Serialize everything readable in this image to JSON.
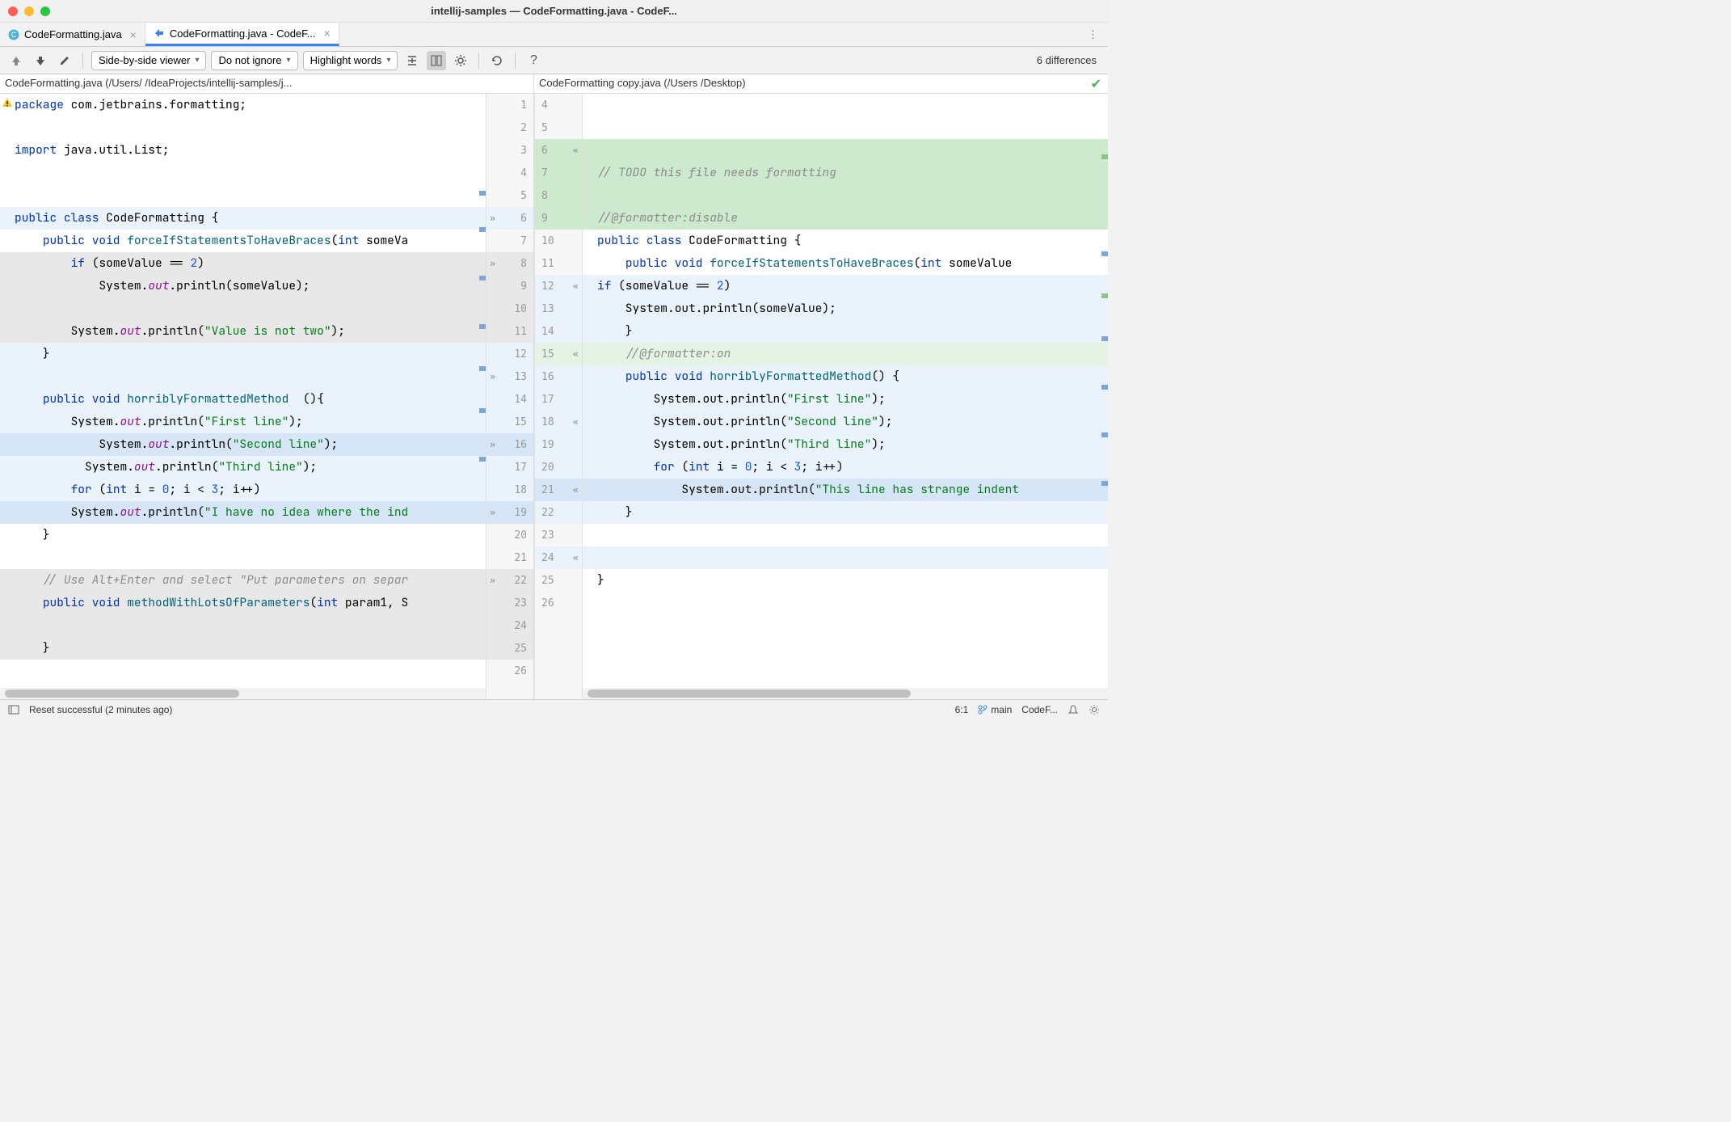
{
  "window": {
    "title": "intellij-samples — CodeFormatting.java - CodeF..."
  },
  "tabs": [
    {
      "label": "CodeFormatting.java",
      "active": false
    },
    {
      "label": "CodeFormatting.java - CodeF...",
      "active": true
    }
  ],
  "toolbar": {
    "viewer_mode": "Side-by-side viewer",
    "ignore_mode": "Do not ignore",
    "highlight_mode": "Highlight words",
    "diff_count": "6 differences"
  },
  "paths": {
    "left": "CodeFormatting.java (/Users/                             /IdeaProjects/intellij-samples/j...",
    "right": "CodeFormatting copy.java (/Users /Desktop)"
  },
  "left_code": [
    {
      "n": 1,
      "segs": [
        [
          "kw",
          "package"
        ],
        [
          "",
          " com.jetbrains.formatting;"
        ]
      ]
    },
    {
      "n": 2,
      "segs": [
        [
          "",
          ""
        ]
      ]
    },
    {
      "n": 3,
      "segs": [
        [
          "kw",
          "import"
        ],
        [
          "",
          " java.util.List;"
        ]
      ]
    },
    {
      "n": 4,
      "segs": [
        [
          "",
          ""
        ]
      ]
    },
    {
      "n": 5,
      "segs": [
        [
          "",
          ""
        ]
      ]
    },
    {
      "n": 6,
      "bg": "mod-light",
      "chev": ">>",
      "segs": [
        [
          "kw",
          "public class"
        ],
        [
          "",
          " CodeFormatting {"
        ]
      ]
    },
    {
      "n": 7,
      "segs": [
        [
          "",
          "    "
        ],
        [
          "kw",
          "public void"
        ],
        [
          "",
          " "
        ],
        [
          "mtd",
          "forceIfStatementsToHaveBraces"
        ],
        [
          "",
          "("
        ],
        [
          "kw",
          "int"
        ],
        [
          "",
          " someVa"
        ]
      ]
    },
    {
      "n": 8,
      "bg": "grey",
      "chev": ">>",
      "segs": [
        [
          "",
          "        "
        ],
        [
          "kw",
          "if"
        ],
        [
          "",
          " (someValue == "
        ],
        [
          "num",
          "2"
        ],
        [
          "",
          ")"
        ]
      ]
    },
    {
      "n": 9,
      "bg": "grey",
      "segs": [
        [
          "",
          "            System."
        ],
        [
          "fld",
          "out"
        ],
        [
          "",
          ".println(someValue);"
        ]
      ]
    },
    {
      "n": 10,
      "bg": "grey",
      "segs": [
        [
          "",
          ""
        ]
      ]
    },
    {
      "n": 11,
      "bg": "grey",
      "segs": [
        [
          "",
          "        System."
        ],
        [
          "fld",
          "out"
        ],
        [
          "",
          ".println("
        ],
        [
          "str",
          "\"Value is not two\""
        ],
        [
          "",
          ");"
        ]
      ]
    },
    {
      "n": 12,
      "bg": "mod-light",
      "segs": [
        [
          "",
          "    }"
        ]
      ]
    },
    {
      "n": 13,
      "bg": "mod-light",
      "chev": ">>",
      "segs": [
        [
          "",
          ""
        ]
      ]
    },
    {
      "n": 14,
      "bg": "mod-light",
      "segs": [
        [
          "",
          "    "
        ],
        [
          "kw",
          "public void"
        ],
        [
          "",
          " "
        ],
        [
          "mtd",
          "horriblyFormattedMethod"
        ],
        [
          "",
          "  (){"
        ]
      ]
    },
    {
      "n": 15,
      "bg": "mod-light",
      "segs": [
        [
          "",
          "        System."
        ],
        [
          "fld",
          "out"
        ],
        [
          "",
          ".println("
        ],
        [
          "str",
          "\"First line\""
        ],
        [
          "",
          ");"
        ]
      ]
    },
    {
      "n": 16,
      "bg": "mod",
      "chev": ">>",
      "segs": [
        [
          "",
          "            System."
        ],
        [
          "fld",
          "out"
        ],
        [
          "",
          ".println("
        ],
        [
          "str",
          "\"Second line\""
        ],
        [
          "",
          ");"
        ]
      ]
    },
    {
      "n": 17,
      "bg": "mod-light",
      "segs": [
        [
          "",
          "          System."
        ],
        [
          "fld",
          "out"
        ],
        [
          "",
          ".println("
        ],
        [
          "str",
          "\"Third line\""
        ],
        [
          "",
          ");"
        ]
      ]
    },
    {
      "n": 18,
      "bg": "mod-light",
      "segs": [
        [
          "",
          "        "
        ],
        [
          "kw",
          "for"
        ],
        [
          "",
          " ("
        ],
        [
          "kw",
          "int"
        ],
        [
          "",
          " i = "
        ],
        [
          "num",
          "0"
        ],
        [
          "",
          "; i < "
        ],
        [
          "num",
          "3"
        ],
        [
          "",
          "; i++)"
        ]
      ]
    },
    {
      "n": 19,
      "bg": "mod",
      "chev": ">>",
      "segs": [
        [
          "",
          "        System."
        ],
        [
          "fld",
          "out"
        ],
        [
          "",
          ".println("
        ],
        [
          "str",
          "\"I have no idea where the ind"
        ]
      ]
    },
    {
      "n": 20,
      "segs": [
        [
          "",
          "    }"
        ]
      ]
    },
    {
      "n": 21,
      "segs": [
        [
          "",
          ""
        ]
      ]
    },
    {
      "n": 22,
      "bg": "grey",
      "chev": ">>",
      "segs": [
        [
          "",
          "    "
        ],
        [
          "cmt",
          "// Use Alt+Enter and select \"Put parameters on separ"
        ]
      ]
    },
    {
      "n": 23,
      "bg": "grey",
      "segs": [
        [
          "",
          "    "
        ],
        [
          "kw",
          "public void"
        ],
        [
          "",
          " "
        ],
        [
          "mtd",
          "methodWithLotsOfParameters"
        ],
        [
          "",
          "("
        ],
        [
          "kw",
          "int"
        ],
        [
          "",
          " param1, S"
        ]
      ]
    },
    {
      "n": 24,
      "bg": "grey",
      "segs": [
        [
          "",
          ""
        ]
      ]
    },
    {
      "n": 25,
      "bg": "grey",
      "segs": [
        [
          "",
          "    }"
        ]
      ]
    },
    {
      "n": 26,
      "segs": [
        [
          "",
          ""
        ]
      ]
    }
  ],
  "right_code": [
    {
      "n": 4,
      "segs": [
        [
          "",
          ""
        ]
      ]
    },
    {
      "n": 5,
      "segs": [
        [
          "",
          ""
        ]
      ]
    },
    {
      "n": 6,
      "bg": "ins",
      "chev": "<<",
      "segs": [
        [
          "",
          ""
        ]
      ]
    },
    {
      "n": 7,
      "bg": "ins",
      "segs": [
        [
          "cmt",
          "// TODO this file needs formatting"
        ]
      ]
    },
    {
      "n": 8,
      "bg": "ins",
      "segs": [
        [
          "",
          ""
        ]
      ]
    },
    {
      "n": 9,
      "bg": "ins",
      "segs": [
        [
          "cmt",
          "//@formatter:disable"
        ]
      ]
    },
    {
      "n": 10,
      "segs": [
        [
          "kw",
          "public class"
        ],
        [
          "",
          " CodeFormatting {"
        ]
      ]
    },
    {
      "n": 11,
      "segs": [
        [
          "",
          "    "
        ],
        [
          "kw",
          "public void"
        ],
        [
          "",
          " "
        ],
        [
          "mtd",
          "forceIfStatementsToHaveBraces"
        ],
        [
          "",
          "("
        ],
        [
          "kw",
          "int"
        ],
        [
          "",
          " someValue"
        ]
      ]
    },
    {
      "n": 12,
      "bg": "mod-light",
      "chev": "<<",
      "segs": [
        [
          "kw",
          "if"
        ],
        [
          "",
          " (someValue == "
        ],
        [
          "num",
          "2"
        ],
        [
          "",
          ")"
        ]
      ]
    },
    {
      "n": 13,
      "bg": "mod-light",
      "segs": [
        [
          "",
          "    System.out.println(someValue);"
        ]
      ]
    },
    {
      "n": 14,
      "bg": "mod-light",
      "segs": [
        [
          "",
          "    }"
        ]
      ]
    },
    {
      "n": 15,
      "bg": "ins-light",
      "chev": "<<",
      "segs": [
        [
          "",
          "    "
        ],
        [
          "cmt",
          "//@formatter:on"
        ]
      ]
    },
    {
      "n": 16,
      "bg": "mod-light",
      "segs": [
        [
          "",
          "    "
        ],
        [
          "kw",
          "public void"
        ],
        [
          "",
          " "
        ],
        [
          "mtd",
          "horriblyFormattedMethod"
        ],
        [
          "",
          "() {"
        ]
      ]
    },
    {
      "n": 17,
      "bg": "mod-light",
      "segs": [
        [
          "",
          "        System.out.println("
        ],
        [
          "str",
          "\"First line\""
        ],
        [
          "",
          ");"
        ]
      ]
    },
    {
      "n": 18,
      "bg": "mod-light",
      "chev": "<<",
      "segs": [
        [
          "",
          "        System.out.println("
        ],
        [
          "str",
          "\"Second line\""
        ],
        [
          "",
          ");"
        ]
      ]
    },
    {
      "n": 19,
      "bg": "mod-light",
      "segs": [
        [
          "",
          "        System.out.println("
        ],
        [
          "str",
          "\"Third line\""
        ],
        [
          "",
          ");"
        ]
      ]
    },
    {
      "n": 20,
      "bg": "mod-light",
      "segs": [
        [
          "",
          "        "
        ],
        [
          "kw",
          "for"
        ],
        [
          "",
          " ("
        ],
        [
          "kw",
          "int"
        ],
        [
          "",
          " i = "
        ],
        [
          "num",
          "0"
        ],
        [
          "",
          "; i < "
        ],
        [
          "num",
          "3"
        ],
        [
          "",
          "; i++)"
        ]
      ]
    },
    {
      "n": 21,
      "bg": "mod",
      "chev": "<<",
      "segs": [
        [
          "",
          "            System.out.println("
        ],
        [
          "str",
          "\"This line has strange indent"
        ]
      ]
    },
    {
      "n": 22,
      "bg": "mod-light",
      "segs": [
        [
          "",
          "    }"
        ]
      ]
    },
    {
      "n": 23,
      "segs": [
        [
          "",
          ""
        ]
      ]
    },
    {
      "n": 24,
      "bg": "mod-light",
      "chev": "<<",
      "segs": [
        [
          "",
          ""
        ]
      ]
    },
    {
      "n": 25,
      "segs": [
        [
          "",
          "}"
        ]
      ]
    },
    {
      "n": 26,
      "segs": [
        [
          "",
          ""
        ]
      ]
    }
  ],
  "status": {
    "message": "Reset successful (2 minutes ago)",
    "cursor": "6:1",
    "branch": "main",
    "branch_label": "CodeF..."
  }
}
